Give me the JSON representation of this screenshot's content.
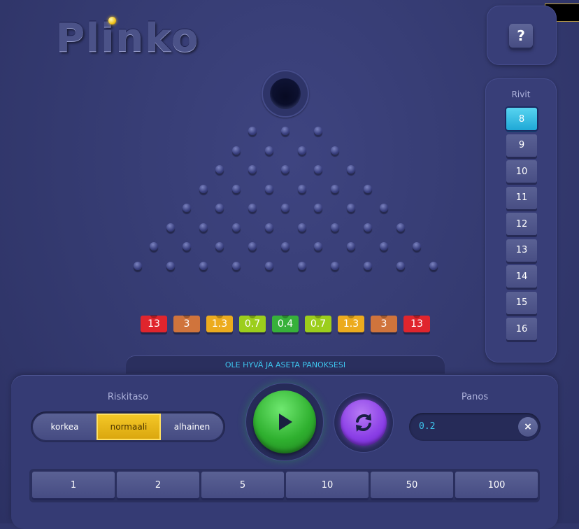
{
  "header": {
    "logo_text": "Plinko",
    "help_label": "?"
  },
  "rows": {
    "title": "Rivit",
    "options": [
      "8",
      "9",
      "10",
      "11",
      "12",
      "13",
      "14",
      "15",
      "16"
    ],
    "selected": "8"
  },
  "board": {
    "peg_rows": 8,
    "multipliers": [
      {
        "label": "13",
        "color": "#e0252d"
      },
      {
        "label": "3",
        "color": "#d0743c"
      },
      {
        "label": "1.3",
        "color": "#ecab1e"
      },
      {
        "label": "0.7",
        "color": "#9cce1c"
      },
      {
        "label": "0.4",
        "color": "#37b13a"
      },
      {
        "label": "0.7",
        "color": "#9cce1c"
      },
      {
        "label": "1.3",
        "color": "#ecab1e"
      },
      {
        "label": "3",
        "color": "#d0743c"
      },
      {
        "label": "13",
        "color": "#e0252d"
      }
    ]
  },
  "status": {
    "message": "OLE HYVÄ JA ASETA PANOKSESI"
  },
  "controls": {
    "risk_label": "Riskitaso",
    "risk_options": [
      "korkea",
      "normaali",
      "alhainen"
    ],
    "risk_selected": "normaali",
    "bet_label": "Panos",
    "bet_value": "0.2",
    "clear_label": "×",
    "quick_bets": [
      "1",
      "2",
      "5",
      "10",
      "50",
      "100"
    ]
  },
  "colors": {
    "accent_cyan": "#3ec5ee",
    "play_green": "#2fb02f",
    "auto_purple": "#8a3ee6",
    "risk_active_yellow": "#f5c928"
  }
}
